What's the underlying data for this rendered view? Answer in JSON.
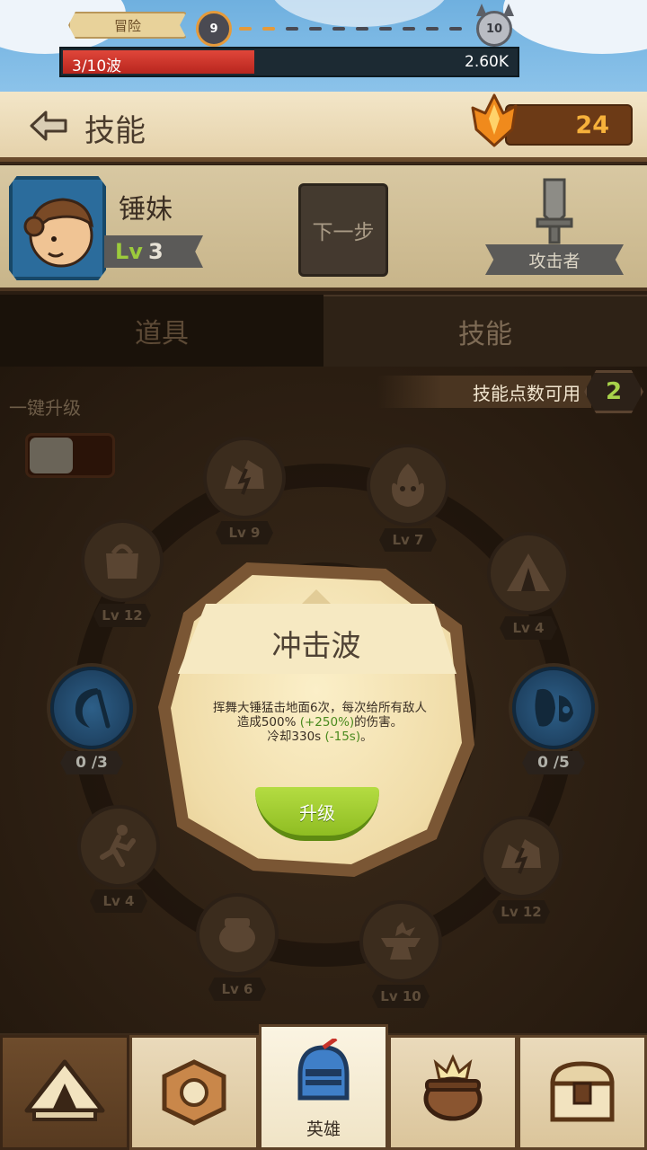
{
  "top_bar": {
    "stage_label": "冒险",
    "current_stage": "9",
    "boss_stage": "10",
    "wave_label": "3/10波",
    "wave_progress": 0.3,
    "damage_value": "2.60K"
  },
  "header": {
    "title": "技能",
    "crystal_count": "24"
  },
  "hero": {
    "name": "锤妹",
    "level_prefix": "Lv",
    "level": "3",
    "next_step_label": "下一步",
    "role": "攻击者"
  },
  "tabs": [
    {
      "label": "道具",
      "selected": false
    },
    {
      "label": "技能",
      "selected": true
    }
  ],
  "skill_panel": {
    "one_click_label": "一键升级",
    "points_label": "技能点数可用",
    "points_value": "2",
    "skills": [
      {
        "name": "lightning",
        "level_label": "Lv 9"
      },
      {
        "name": "fire-face",
        "level_label": "Lv 7"
      },
      {
        "name": "tent",
        "level_label": "Lv 4"
      },
      {
        "name": "mask",
        "level_label": "0 /5"
      },
      {
        "name": "storm",
        "level_label": "Lv 12"
      },
      {
        "name": "anvil",
        "level_label": "Lv 10"
      },
      {
        "name": "pot",
        "level_label": "Lv 6"
      },
      {
        "name": "runner",
        "level_label": "Lv 4"
      },
      {
        "name": "scythe",
        "level_label": "0 /3"
      },
      {
        "name": "bag",
        "level_label": "Lv 12"
      }
    ]
  },
  "popup": {
    "title": "冲击波",
    "desc_line1": "挥舞大锤猛击地面6次，每次给所有敌人",
    "desc_line2_a": "造成500% ",
    "desc_line2_b": "(+250%)",
    "desc_line2_c": "的伤害。",
    "desc_line3_a": "冷却330s ",
    "desc_line3_b": "(-15s)",
    "desc_line3_c": "。",
    "upgrade_label": "升级"
  },
  "bottom_nav": [
    {
      "icon": "camp-icon",
      "label": ""
    },
    {
      "icon": "gear-shield-icon",
      "label": ""
    },
    {
      "icon": "knight-helmet-icon",
      "label": "英雄"
    },
    {
      "icon": "cauldron-icon",
      "label": ""
    },
    {
      "icon": "treasure-chest-icon",
      "label": ""
    }
  ],
  "colors": {
    "wave_fill": "#e0463a",
    "level_green": "#9ccb3c",
    "accent_orange": "#f6b13b",
    "upgrade_green": "#8fbd22"
  }
}
